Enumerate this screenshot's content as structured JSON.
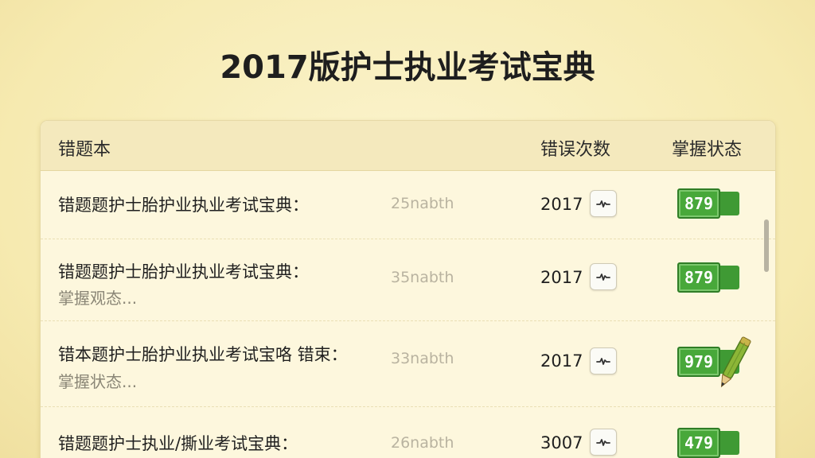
{
  "app": {
    "title": "2017版护士执业考试宝典"
  },
  "table": {
    "headers": {
      "title": "错题本",
      "count": "错误次数",
      "status": "掌握状态"
    },
    "rows": [
      {
        "title": "错题题护士胎护业执业考试宝典：",
        "subtitle": "",
        "meta": "25nabth",
        "count": "2017",
        "badge": "879"
      },
      {
        "title": "错题题护士胎护业执业考试宝典：",
        "subtitle": "掌握观态...",
        "meta": "35nabth",
        "count": "2017",
        "badge": "879"
      },
      {
        "title": "错本题护士胎护业执业考试宝咯 错束：",
        "subtitle": "掌握状态...",
        "meta": "33nabth",
        "count": "2017",
        "badge": "979"
      },
      {
        "title": "错题题护士执业/撕业考试宝典：",
        "subtitle": "",
        "meta": "26nabth",
        "count": "3007",
        "badge": "479"
      }
    ]
  },
  "icons": {
    "chart": "pulse-chart-icon",
    "pencil": "pencil-icon"
  },
  "colors": {
    "background": "#f7edb4",
    "badge_green": "#48a83a",
    "card": "#fdf7dd"
  }
}
